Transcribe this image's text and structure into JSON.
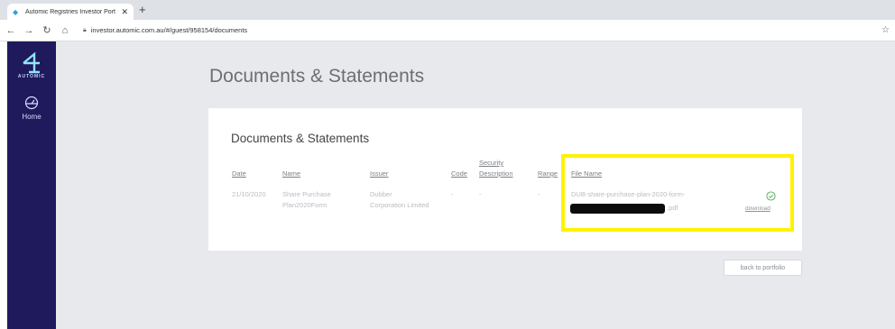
{
  "browser": {
    "tab_title": "Automic Registries Investor Port",
    "tab_close": "✕",
    "new_tab": "+",
    "url": "investor.automic.com.au/#/guest/958154/documents"
  },
  "sidebar": {
    "logo_text": "AUTOMIC",
    "home_label": "Home"
  },
  "page": {
    "title": "Documents & Statements"
  },
  "card": {
    "title": "Documents & Statements",
    "columns": {
      "date": "Date",
      "name": "Name",
      "issuer": "Issuer",
      "code": "Code",
      "security_description_line1": "Security",
      "security_description_line2": "Description",
      "range": "Range",
      "file_name": "File Name"
    },
    "row": {
      "date": "21/10/2020",
      "name_line1": "Share Purchase",
      "name_line2": "Plan2020Form",
      "issuer_line1": "Dubber",
      "issuer_line2": "Corporation Limited",
      "code": "-",
      "security_description": "-",
      "range": "-",
      "file_name_line1": "DUB-share-purchase-plan-2020-form-",
      "file_name_suffix": ".pdf",
      "download": "download"
    }
  },
  "actions": {
    "back_label": "back to portfolio"
  },
  "colors": {
    "sidebar": "#1e1a5c",
    "highlight": "#fff200",
    "check": "#4caf50"
  }
}
